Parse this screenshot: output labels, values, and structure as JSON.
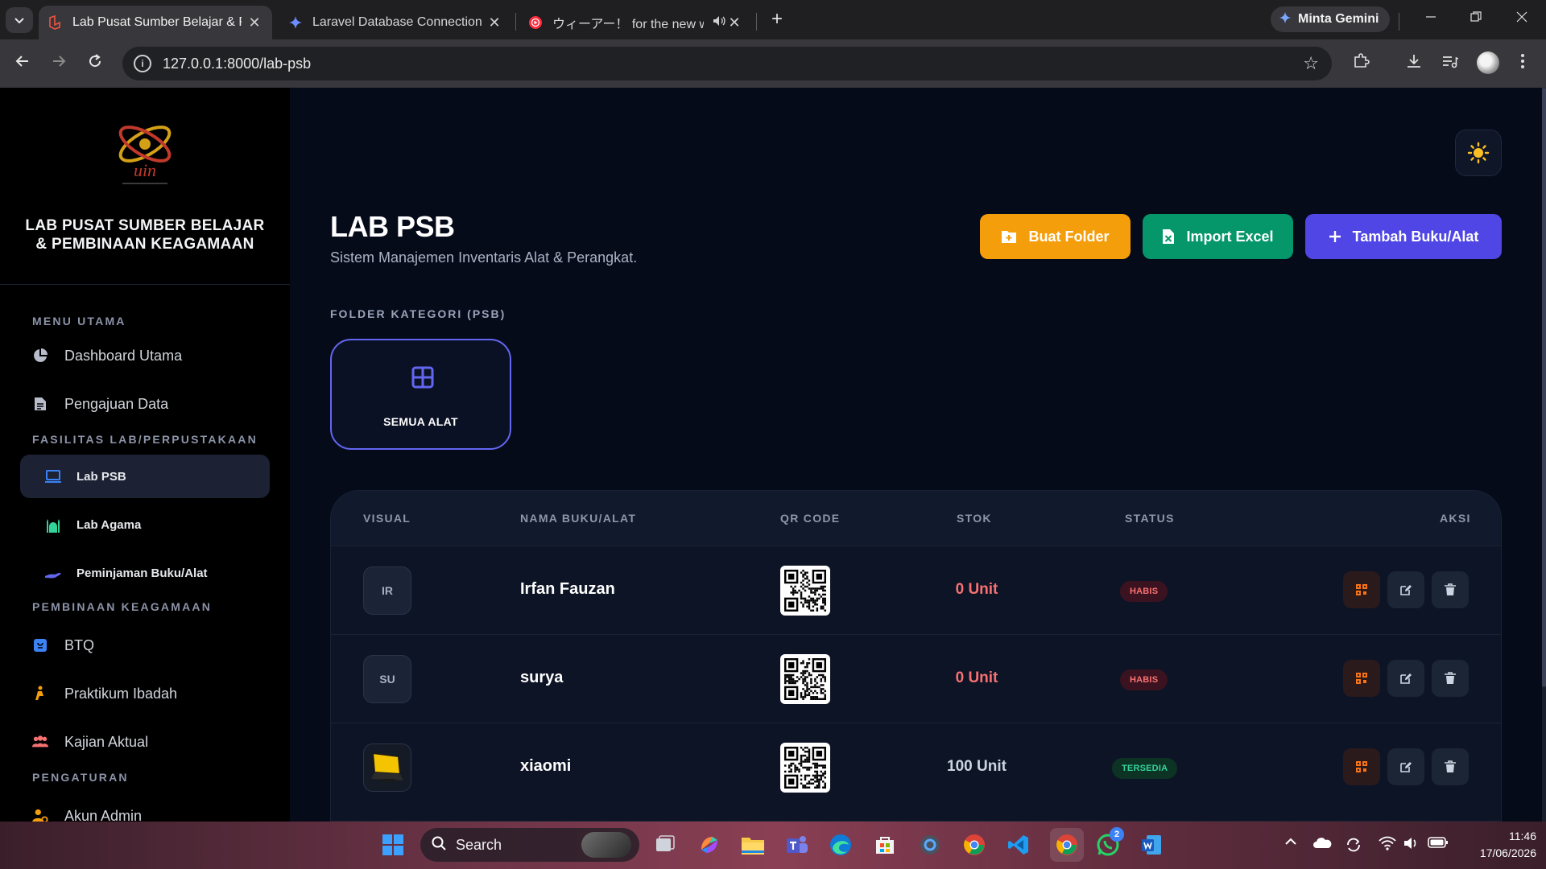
{
  "browser": {
    "tabs": [
      {
        "title": "Lab Pusat Sumber Belajar & Pembinaan",
        "active": true
      },
      {
        "title": "Laravel Database Connection Re",
        "active": false
      },
      {
        "title": "ウィーアー！ for the new world",
        "active": false
      }
    ],
    "gemini_label": "Minta Gemini",
    "url": "127.0.0.1:8000/lab-psb"
  },
  "sidebar": {
    "brand_title": "LAB PUSAT SUMBER BELAJAR & PEMBINAAN KEAGAMAAN",
    "sections": {
      "main_menu": "MENU UTAMA",
      "facilities": "FASILITAS LAB/PERPUSTAKAAN",
      "religious": "PEMBINAAN KEAGAMAAN",
      "settings": "PENGATURAN"
    },
    "items": {
      "dashboard": "Dashboard Utama",
      "submission": "Pengajuan Data",
      "lab_psb": "Lab PSB",
      "lab_agama": "Lab Agama",
      "loan": "Peminjaman Buku/Alat",
      "btq": "BTQ",
      "ibadah": "Praktikum Ibadah",
      "kajian": "Kajian Aktual",
      "admin": "Akun Admin"
    }
  },
  "main": {
    "title": "LAB PSB",
    "subtitle": "Sistem Manajemen Inventaris Alat & Perangkat.",
    "buttons": {
      "folder": "Buat Folder",
      "excel": "Import Excel",
      "add": "Tambah Buku/Alat"
    },
    "folder_section": "FOLDER KATEGORI (PSB)",
    "folder_all": "SEMUA ALAT",
    "table": {
      "headers": {
        "visual": "VISUAL",
        "name": "NAMA BUKU/ALAT",
        "qr": "QR CODE",
        "stock": "STOK",
        "status": "STATUS",
        "action": "AKSI"
      },
      "rows": [
        {
          "initials": "IR",
          "name": "Irfan Fauzan",
          "stock": "0 Unit",
          "status": "HABIS"
        },
        {
          "initials": "SU",
          "name": "surya",
          "stock": "0 Unit",
          "status": "HABIS"
        },
        {
          "initials": "",
          "name": "xiaomi",
          "stock": "100 Unit",
          "status": "TERSEDIA"
        }
      ]
    }
  },
  "taskbar": {
    "search_label": "Search",
    "whatsapp_badge": "2",
    "time": "11:46",
    "date": "17/06/2026"
  },
  "colors": {
    "accent": "#4f46e5",
    "folder_btn": "#f59e0b",
    "excel_btn": "#059669",
    "danger": "#f87171",
    "success": "#34d399"
  }
}
